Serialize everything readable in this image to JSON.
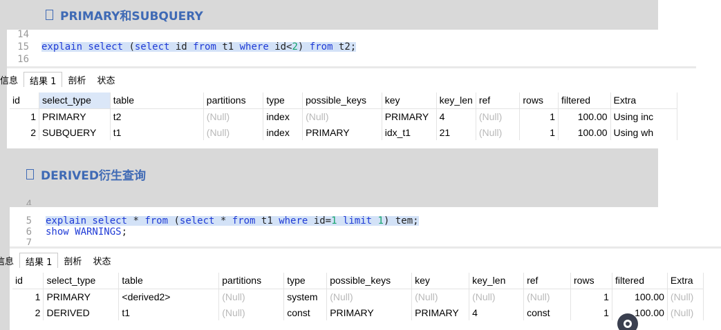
{
  "sections": [
    {
      "heading": "PRIMARY和SUBQUERY",
      "code_lines": [
        {
          "num": "14",
          "text": ""
        },
        {
          "num": "15",
          "text": "explain select (select id from t1 where id<2) from t2;"
        },
        {
          "num": "16",
          "text": ""
        }
      ],
      "tabs": [
        "信息",
        "结果 1",
        "剖析",
        "状态"
      ],
      "columns": [
        "id",
        "select_type",
        "table",
        "partitions",
        "type",
        "possible_keys",
        "key",
        "key_len",
        "ref",
        "rows",
        "filtered",
        "Extra"
      ],
      "rows": [
        [
          "1",
          "PRIMARY",
          "t2",
          "(Null)",
          "index",
          "(Null)",
          "PRIMARY",
          "4",
          "(Null)",
          "1",
          "100.00",
          "Using inc"
        ],
        [
          "2",
          "SUBQUERY",
          "t1",
          "(Null)",
          "index",
          "PRIMARY",
          "idx_t1",
          "21",
          "(Null)",
          "1",
          "100.00",
          "Using wh"
        ]
      ]
    },
    {
      "heading": "DERIVED衍生查询",
      "code_lines": [
        {
          "num": "4",
          "text": ""
        },
        {
          "num": "5",
          "text": "explain select * from (select * from t1 where id=1 limit 1) tem;"
        },
        {
          "num": "6",
          "text": "show WARNINGS;"
        },
        {
          "num": "7",
          "text": ""
        }
      ],
      "tabs": [
        "信息",
        "结果 1",
        "剖析",
        "状态"
      ],
      "columns": [
        "id",
        "select_type",
        "table",
        "partitions",
        "type",
        "possible_keys",
        "key",
        "key_len",
        "ref",
        "rows",
        "filtered",
        "Extra"
      ],
      "rows": [
        [
          "1",
          "PRIMARY",
          "<derived2>",
          "(Null)",
          "system",
          "(Null)",
          "(Null)",
          "(Null)",
          "(Null)",
          "1",
          "100.00",
          "(Null)"
        ],
        [
          "2",
          "DERIVED",
          "t1",
          "(Null)",
          "const",
          "PRIMARY",
          "PRIMARY",
          "4",
          "const",
          "1",
          "100.00",
          "(Null)"
        ]
      ]
    }
  ],
  "icons": {
    "bullet": "square-bullet-icon",
    "fab": "floating-action-icon"
  },
  "colors": {
    "heading": "#3f6ab5",
    "keyword": "#1f3bd6",
    "number": "#13a36b",
    "null": "#b9b9b9",
    "highlight": "#d3e2f7"
  }
}
